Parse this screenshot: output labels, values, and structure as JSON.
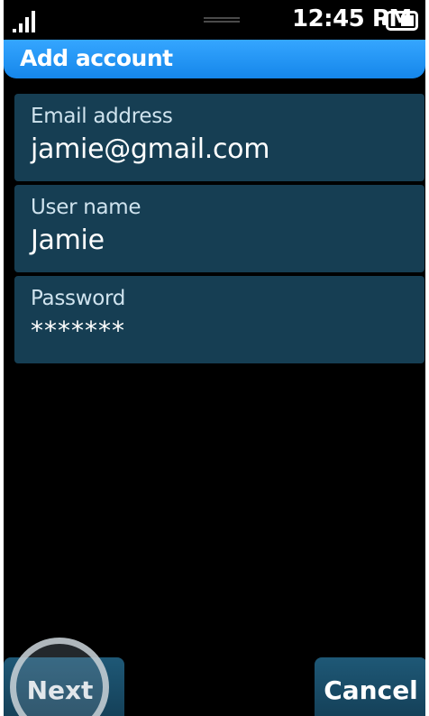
{
  "status_bar": {
    "time": "12:45 PM",
    "signal_icon": "signal-bars-icon",
    "battery_icon": "battery-icon"
  },
  "header": {
    "title": "Add account"
  },
  "form": {
    "email": {
      "label": "Email address",
      "value": "jamie@gmail.com"
    },
    "username": {
      "label": "User name",
      "value": "Jamie"
    },
    "password": {
      "label": "Password",
      "value": "*******"
    }
  },
  "buttons": {
    "next": "Next",
    "cancel": "Cancel"
  },
  "colors": {
    "header_blue": "#1586ea",
    "field_bg": "#163e53",
    "button_bg": "#1e5876"
  }
}
